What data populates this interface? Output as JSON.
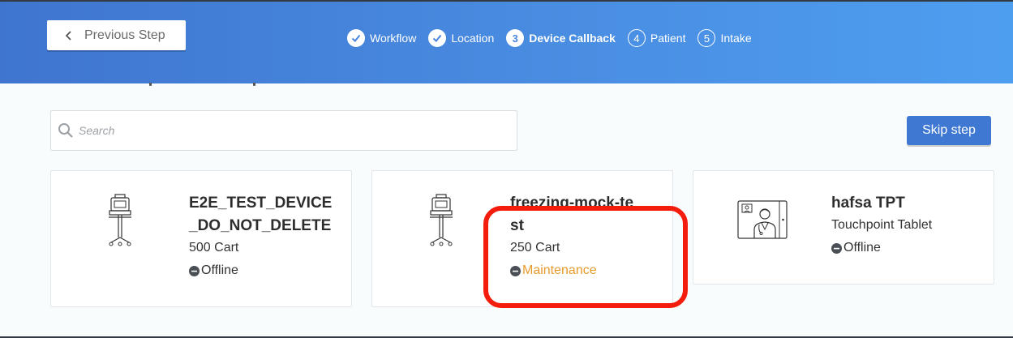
{
  "header": {
    "previous_step_label": "Previous Step",
    "steps": [
      {
        "number": "1",
        "label": "Workflow",
        "state": "done"
      },
      {
        "number": "2",
        "label": "Location",
        "state": "done"
      },
      {
        "number": "3",
        "label": "Device Callback",
        "state": "current"
      },
      {
        "number": "4",
        "label": "Patient",
        "state": "todo"
      },
      {
        "number": "5",
        "label": "Intake",
        "state": "todo"
      }
    ]
  },
  "search": {
    "placeholder": "Search",
    "value": ""
  },
  "skip_label": "Skip step",
  "devices": [
    {
      "name_line1": "E2E_TEST_DEVICE",
      "name_line2": "_DO_NOT_DELETE",
      "type": "500 Cart",
      "status": "Offline",
      "icon": "cart-icon"
    },
    {
      "name_line1": "freezing-mock-te",
      "name_line2": "st",
      "type": "250 Cart",
      "status": "Maintenance",
      "icon": "cart-icon"
    },
    {
      "name_line1": "hafsa TPT",
      "name_line2": "",
      "type": "Touchpoint Tablet",
      "status": "Offline",
      "icon": "tablet-doctor-icon"
    }
  ],
  "colors": {
    "header_start": "#3f75cf",
    "header_end": "#4e9ef0",
    "accent": "#3e78d2",
    "maintenance": "#e89a2a",
    "highlight": "#f41c0c"
  }
}
